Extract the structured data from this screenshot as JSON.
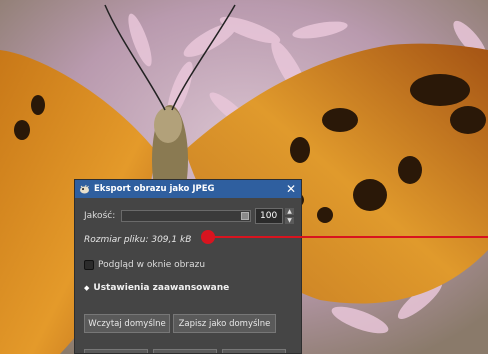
{
  "dialog": {
    "title": "Eksport obrazu jako JPEG",
    "close_glyph": "✕",
    "quality": {
      "label": "Jakość:",
      "value": "100",
      "slider_fraction": 1.0
    },
    "file_size_text": "Rozmiar pliku: 309,1 kB",
    "preview_checkbox": {
      "label": "Podgląd w oknie obrazu",
      "checked": false
    },
    "advanced_expander": {
      "label": "Ustawienia zaawansowane",
      "glyph": "◆"
    },
    "buttons": {
      "load_defaults": "Wczytaj domyślne",
      "save_defaults": "Zapisz jako domyślne"
    }
  },
  "icons": {
    "app": "gimp-wilber-icon",
    "close": "close-icon",
    "spin_up": "spin-up-icon",
    "spin_down": "spin-down-icon"
  },
  "colors": {
    "titlebar": "#2f5f9f",
    "dialog_bg": "#454545",
    "callout": "#d8141f"
  }
}
